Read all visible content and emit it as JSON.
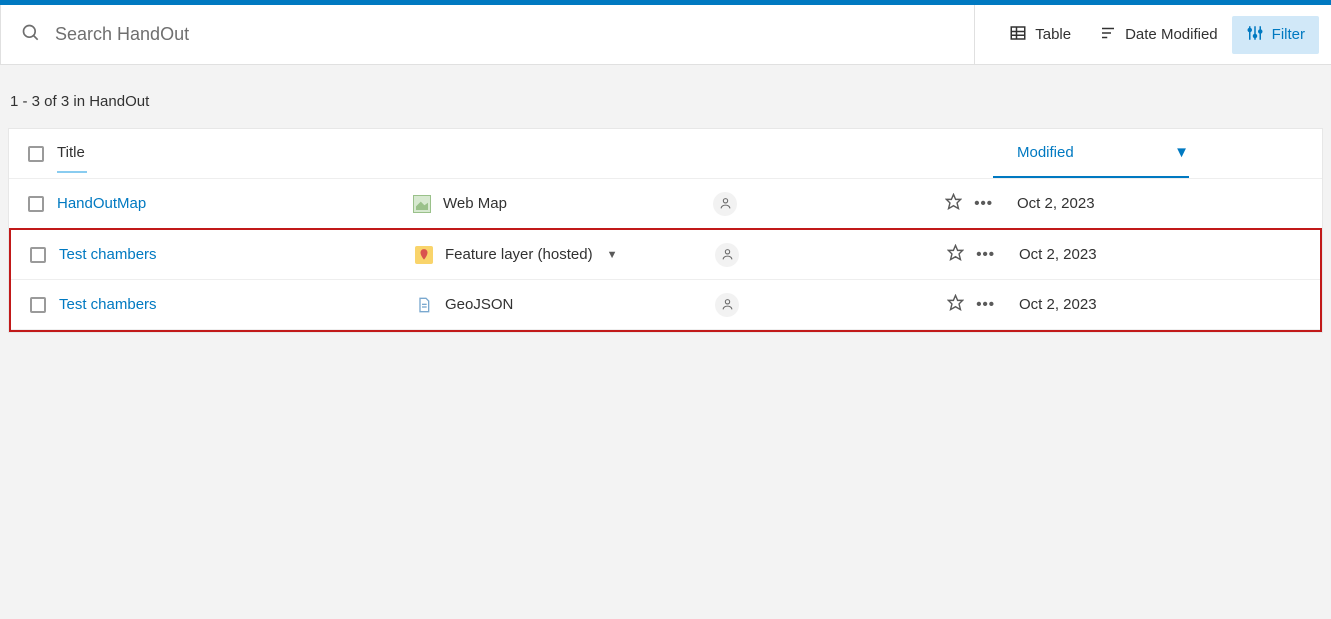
{
  "search": {
    "placeholder": "Search HandOut"
  },
  "toolbar": {
    "table_label": "Table",
    "date_modified_label": "Date Modified",
    "filter_label": "Filter"
  },
  "count_line": "1 - 3 of 3 in HandOut",
  "columns": {
    "title": "Title",
    "modified": "Modified"
  },
  "rows": [
    {
      "title": "HandOutMap",
      "type": "Web Map",
      "type_icon": "map",
      "has_dropdown": false,
      "share": "owner",
      "modified": "Oct 2, 2023"
    },
    {
      "title": "Test chambers",
      "type": "Feature layer (hosted)",
      "type_icon": "featlayer",
      "has_dropdown": true,
      "share": "owner",
      "modified": "Oct 2, 2023"
    },
    {
      "title": "Test chambers",
      "type": "GeoJSON",
      "type_icon": "doc",
      "has_dropdown": false,
      "share": "owner",
      "modified": "Oct 2, 2023"
    }
  ],
  "highlight_rows": [
    1,
    2
  ],
  "colors": {
    "brand_blue": "#0079c1",
    "filter_bg": "#d1e8f8",
    "highlight_border": "#c11919"
  }
}
